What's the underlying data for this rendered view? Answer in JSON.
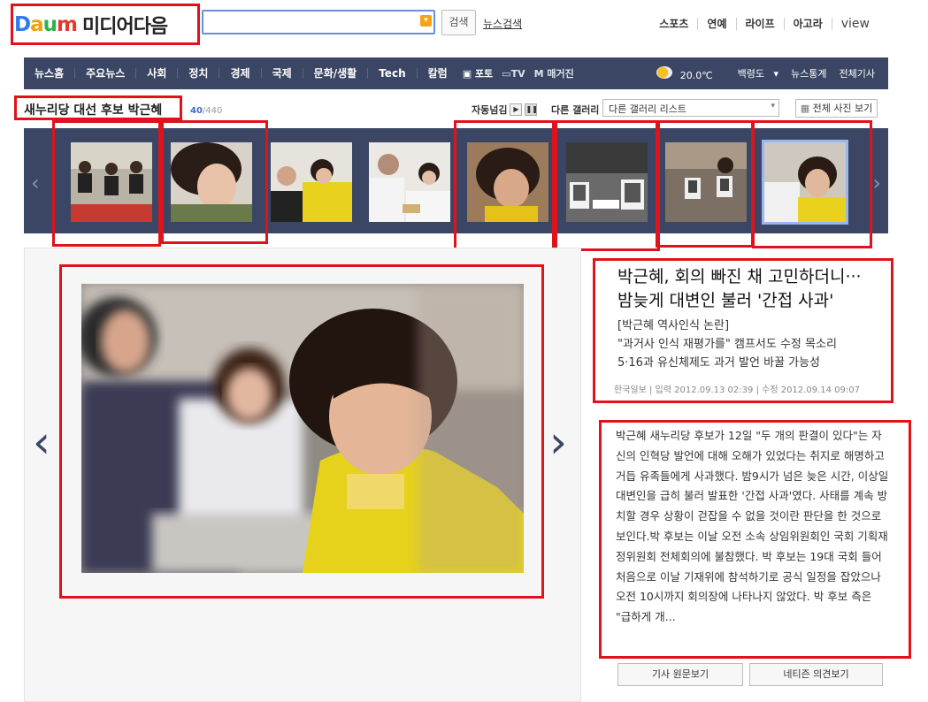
{
  "header": {
    "logo_brand": "Daum",
    "logo_service": "미디어다음",
    "search_button": "검색",
    "news_search": "뉴스검색",
    "top_nav": [
      "스포츠",
      "연예",
      "라이프",
      "아고라",
      "view"
    ]
  },
  "gnb": {
    "items": [
      "뉴스홈",
      "주요뉴스",
      "사회",
      "정치",
      "경제",
      "국제",
      "문화/생활",
      "Tech",
      "칼럼"
    ],
    "small": [
      "포토",
      "TV",
      "매거진"
    ],
    "weather": "20.0℃",
    "location": "백령도",
    "stats": "뉴스통계",
    "all_articles": "전체기사"
  },
  "gallery": {
    "title": "새누리당 대선 후보 박근혜",
    "current": "40",
    "total": "/440",
    "autoplay_label": "자동넘김",
    "other_label": "다른 갤러리",
    "select_value": "다른 갤러리 리스트",
    "all_photos": "전체 사진 보기"
  },
  "article": {
    "title_line1": "박근혜, 회의 빠진 채 고민하더니···",
    "title_line2": "밤늦게 대변인 불러 '간접 사과'",
    "sub1": "[박근혜 역사인식 논란]",
    "sub2": "\"과거사 인식 재평가를\" 캠프서도 수정 목소리",
    "sub3": "5·16과 유신체제도 과거 발언 바꿀 가능성",
    "source": "한국일보",
    "input_time": "입력 2012.09.13 02:39",
    "edit_time": "수정 2012.09.14 09:07",
    "body": "박근혜 새누리당 후보가 12일 \"두 개의 판결이 있다\"는 자신의 인혁당 발언에 대해 오해가 있었다는 취지로 해명하고 거듭 유족들에게 사과했다. 밤9시가 넘은 늦은 시간, 이상일 대변인을 급히 불러 발표한 '간접 사과'였다. 사태를 계속 방치할 경우 상황이 걷잡을 수 없을 것이란 판단을 한 것으로 보인다.박 후보는 이날 오전 소속 상임위원회인 국회 기획재정위원회 전체회의에 불참했다. 박 후보는 19대 국회 들어 처음으로 이날 기재위에 참석하기로 공식 일정을 잡았으나 오전 10시까지 회의장에 나타나지 않았다. 박 후보 측은 \"급하게 개...",
    "btn_original": "기사 원문보기",
    "btn_comments": "네티즌 의견보기"
  },
  "colors": {
    "nav_bg": "#3b4664",
    "highlight": "#e0121b",
    "accent": "#3a6cc9"
  }
}
